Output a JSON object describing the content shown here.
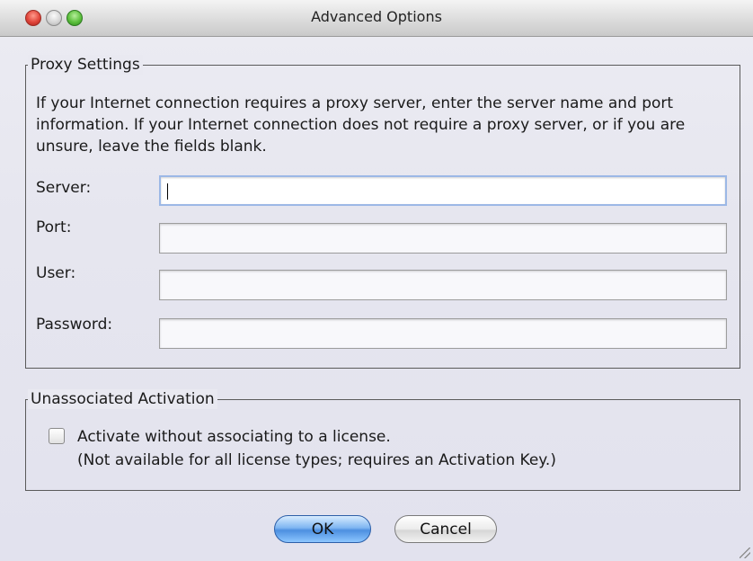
{
  "window": {
    "title": "Advanced Options"
  },
  "proxy": {
    "legend": "Proxy Settings",
    "intro": "If your Internet connection requires a proxy server, enter the server name and port information. If your Internet connection does not require a proxy server, or if you are unsure, leave the fields blank.",
    "fields": [
      {
        "label": "Server:",
        "value": "",
        "focused": true
      },
      {
        "label": "Port:",
        "value": ""
      },
      {
        "label": "User:",
        "value": ""
      },
      {
        "label": "Password:",
        "value": ""
      }
    ]
  },
  "activation": {
    "legend": "Unassociated Activation",
    "checkbox_label": "Activate without associating to a license.",
    "note": "(Not available for all license types; requires an Activation Key.)",
    "checked": false
  },
  "buttons": {
    "ok": "OK",
    "cancel": "Cancel"
  },
  "colors": {
    "default_button": "#4c8fe0",
    "focus_ring": "#9cb8e6"
  }
}
